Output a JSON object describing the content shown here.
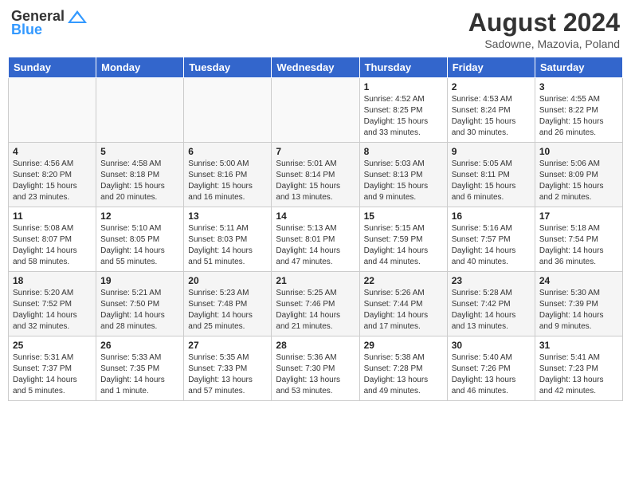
{
  "header": {
    "logo_general": "General",
    "logo_blue": "Blue",
    "title": "August 2024",
    "subtitle": "Sadowne, Mazovia, Poland"
  },
  "weekdays": [
    "Sunday",
    "Monday",
    "Tuesday",
    "Wednesday",
    "Thursday",
    "Friday",
    "Saturday"
  ],
  "weeks": [
    [
      {
        "day": "",
        "info": ""
      },
      {
        "day": "",
        "info": ""
      },
      {
        "day": "",
        "info": ""
      },
      {
        "day": "",
        "info": ""
      },
      {
        "day": "1",
        "info": "Sunrise: 4:52 AM\nSunset: 8:25 PM\nDaylight: 15 hours\nand 33 minutes."
      },
      {
        "day": "2",
        "info": "Sunrise: 4:53 AM\nSunset: 8:24 PM\nDaylight: 15 hours\nand 30 minutes."
      },
      {
        "day": "3",
        "info": "Sunrise: 4:55 AM\nSunset: 8:22 PM\nDaylight: 15 hours\nand 26 minutes."
      }
    ],
    [
      {
        "day": "4",
        "info": "Sunrise: 4:56 AM\nSunset: 8:20 PM\nDaylight: 15 hours\nand 23 minutes."
      },
      {
        "day": "5",
        "info": "Sunrise: 4:58 AM\nSunset: 8:18 PM\nDaylight: 15 hours\nand 20 minutes."
      },
      {
        "day": "6",
        "info": "Sunrise: 5:00 AM\nSunset: 8:16 PM\nDaylight: 15 hours\nand 16 minutes."
      },
      {
        "day": "7",
        "info": "Sunrise: 5:01 AM\nSunset: 8:14 PM\nDaylight: 15 hours\nand 13 minutes."
      },
      {
        "day": "8",
        "info": "Sunrise: 5:03 AM\nSunset: 8:13 PM\nDaylight: 15 hours\nand 9 minutes."
      },
      {
        "day": "9",
        "info": "Sunrise: 5:05 AM\nSunset: 8:11 PM\nDaylight: 15 hours\nand 6 minutes."
      },
      {
        "day": "10",
        "info": "Sunrise: 5:06 AM\nSunset: 8:09 PM\nDaylight: 15 hours\nand 2 minutes."
      }
    ],
    [
      {
        "day": "11",
        "info": "Sunrise: 5:08 AM\nSunset: 8:07 PM\nDaylight: 14 hours\nand 58 minutes."
      },
      {
        "day": "12",
        "info": "Sunrise: 5:10 AM\nSunset: 8:05 PM\nDaylight: 14 hours\nand 55 minutes."
      },
      {
        "day": "13",
        "info": "Sunrise: 5:11 AM\nSunset: 8:03 PM\nDaylight: 14 hours\nand 51 minutes."
      },
      {
        "day": "14",
        "info": "Sunrise: 5:13 AM\nSunset: 8:01 PM\nDaylight: 14 hours\nand 47 minutes."
      },
      {
        "day": "15",
        "info": "Sunrise: 5:15 AM\nSunset: 7:59 PM\nDaylight: 14 hours\nand 44 minutes."
      },
      {
        "day": "16",
        "info": "Sunrise: 5:16 AM\nSunset: 7:57 PM\nDaylight: 14 hours\nand 40 minutes."
      },
      {
        "day": "17",
        "info": "Sunrise: 5:18 AM\nSunset: 7:54 PM\nDaylight: 14 hours\nand 36 minutes."
      }
    ],
    [
      {
        "day": "18",
        "info": "Sunrise: 5:20 AM\nSunset: 7:52 PM\nDaylight: 14 hours\nand 32 minutes."
      },
      {
        "day": "19",
        "info": "Sunrise: 5:21 AM\nSunset: 7:50 PM\nDaylight: 14 hours\nand 28 minutes."
      },
      {
        "day": "20",
        "info": "Sunrise: 5:23 AM\nSunset: 7:48 PM\nDaylight: 14 hours\nand 25 minutes."
      },
      {
        "day": "21",
        "info": "Sunrise: 5:25 AM\nSunset: 7:46 PM\nDaylight: 14 hours\nand 21 minutes."
      },
      {
        "day": "22",
        "info": "Sunrise: 5:26 AM\nSunset: 7:44 PM\nDaylight: 14 hours\nand 17 minutes."
      },
      {
        "day": "23",
        "info": "Sunrise: 5:28 AM\nSunset: 7:42 PM\nDaylight: 14 hours\nand 13 minutes."
      },
      {
        "day": "24",
        "info": "Sunrise: 5:30 AM\nSunset: 7:39 PM\nDaylight: 14 hours\nand 9 minutes."
      }
    ],
    [
      {
        "day": "25",
        "info": "Sunrise: 5:31 AM\nSunset: 7:37 PM\nDaylight: 14 hours\nand 5 minutes."
      },
      {
        "day": "26",
        "info": "Sunrise: 5:33 AM\nSunset: 7:35 PM\nDaylight: 14 hours\nand 1 minute."
      },
      {
        "day": "27",
        "info": "Sunrise: 5:35 AM\nSunset: 7:33 PM\nDaylight: 13 hours\nand 57 minutes."
      },
      {
        "day": "28",
        "info": "Sunrise: 5:36 AM\nSunset: 7:30 PM\nDaylight: 13 hours\nand 53 minutes."
      },
      {
        "day": "29",
        "info": "Sunrise: 5:38 AM\nSunset: 7:28 PM\nDaylight: 13 hours\nand 49 minutes."
      },
      {
        "day": "30",
        "info": "Sunrise: 5:40 AM\nSunset: 7:26 PM\nDaylight: 13 hours\nand 46 minutes."
      },
      {
        "day": "31",
        "info": "Sunrise: 5:41 AM\nSunset: 7:23 PM\nDaylight: 13 hours\nand 42 minutes."
      }
    ]
  ]
}
